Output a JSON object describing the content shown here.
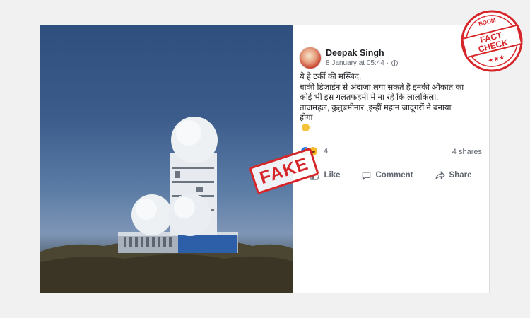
{
  "post": {
    "author": "Deepak Singh",
    "timestamp": "8 January at 05:44 ·",
    "privacy_icon": "globe-icon",
    "text_lines": [
      "ये है टर्की की मस्जिद,",
      "बाकी डिज़ाईन से अंदाजा लगा सकते हैं इनकी औकात का",
      "कोई भी इस गलतफहमी में ना रहे कि लालकिला,",
      "ताजमहल, कुतुबमीनार ,इन्हीं महान जादूगरों ने बनाया",
      "होगा"
    ],
    "reactions_count": "4",
    "shares": "4 shares",
    "actions": {
      "like": "Like",
      "comment": "Comment",
      "share": "Share"
    }
  },
  "overlay": {
    "fake_label": "FAKE",
    "badge_logo": "BOOM",
    "badge_line1": "FACT",
    "badge_line2": "CHECK",
    "badge_stars": "★★★"
  },
  "colors": {
    "fake_red": "#d7262a",
    "facebook_blue": "#1877f2",
    "sky_blue": "#3c5d8c"
  }
}
